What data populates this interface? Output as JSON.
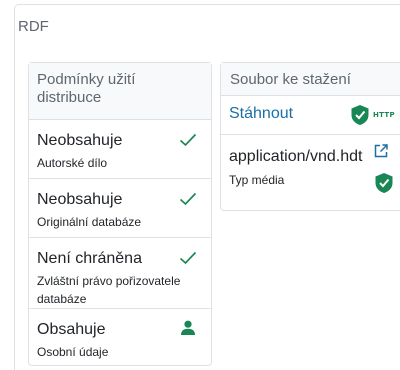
{
  "section": {
    "title": "RDF"
  },
  "terms": {
    "header": "Podmínky užití distribuce",
    "items": [
      {
        "status": "Neobsahuje",
        "label": "Autorské dílo",
        "icon": "check-icon"
      },
      {
        "status": "Neobsahuje",
        "label": "Originální databáze",
        "icon": "check-icon"
      },
      {
        "status": "Není chráněna",
        "label": "Zvláštní právo pořizovatele databáze",
        "icon": "check-icon"
      },
      {
        "status": "Obsahuje",
        "label": "Osobní údaje",
        "icon": "user-icon"
      }
    ]
  },
  "download": {
    "header": "Soubor ke stažení",
    "link_label": "Stáhnout",
    "badge_text": "HTTP",
    "media_type_value": "application/vnd.hdt",
    "media_type_label": "Typ média"
  },
  "colors": {
    "accent_green": "#198754",
    "link_blue": "#1a6fa5",
    "border": "#dee2e6",
    "header_bg": "#f8f9fa"
  }
}
